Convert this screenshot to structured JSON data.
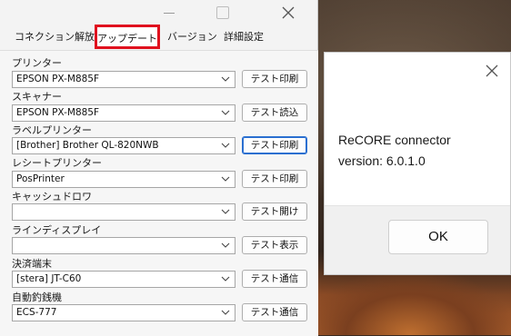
{
  "main_window": {
    "tabs": [
      "コネクション解放",
      "アップデート",
      "バージョン",
      "詳細設定"
    ],
    "devices": [
      {
        "label": "プリンター",
        "value": "EPSON PX-M885F",
        "button": "テスト印刷"
      },
      {
        "label": "スキャナー",
        "value": "EPSON PX-M885F",
        "button": "テスト読込"
      },
      {
        "label": "ラベルプリンター",
        "value": "[Brother] Brother QL-820NWB",
        "button": "テスト印刷"
      },
      {
        "label": "レシートプリンター",
        "value": "PosPrinter",
        "button": "テスト印刷"
      },
      {
        "label": "キャッシュドロワ",
        "value": "",
        "button": "テスト開け"
      },
      {
        "label": "ラインディスプレイ",
        "value": "",
        "button": "テスト表示"
      },
      {
        "label": "決済端末",
        "value": "[stera] JT-C60",
        "button": "テスト通信"
      },
      {
        "label": "自動釣銭機",
        "value": "ECS-777",
        "button": "テスト通信"
      }
    ]
  },
  "about_dialog": {
    "app_name": "ReCORE connector",
    "version": "version: 6.0.1.0",
    "ok_label": "OK"
  }
}
